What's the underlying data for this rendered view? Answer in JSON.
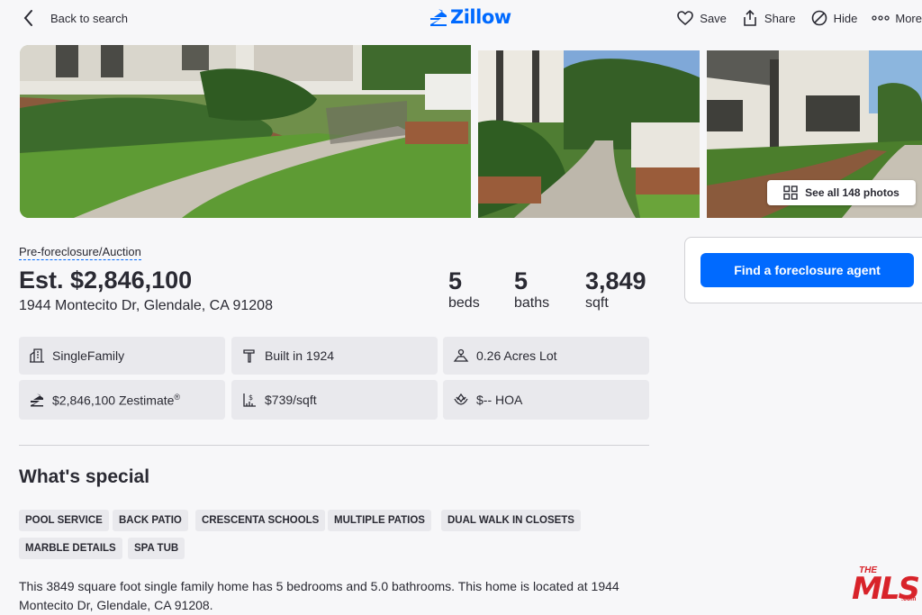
{
  "nav": {
    "back_label": "Back to search",
    "logo_text": "Zillow",
    "actions": {
      "save": "Save",
      "share": "Share",
      "hide": "Hide",
      "more": "More"
    }
  },
  "gallery": {
    "see_all_label": "See all 148 photos"
  },
  "listing": {
    "status": "Pre-foreclosure/Auction",
    "price": "Est. $2,846,100",
    "address": "1944 Montecito Dr, Glendale, CA 91208",
    "beds": {
      "value": "5",
      "label": "beds"
    },
    "baths": {
      "value": "5",
      "label": "baths"
    },
    "sqft": {
      "value": "3,849",
      "label": "sqft"
    }
  },
  "agent": {
    "button_label": "Find a foreclosure agent"
  },
  "facts": [
    {
      "icon": "building-icon",
      "text": "SingleFamily"
    },
    {
      "icon": "hammer-icon",
      "text": "Built in 1924"
    },
    {
      "icon": "lot-icon",
      "text": "0.26 Acres Lot"
    },
    {
      "icon": "zestimate-icon",
      "text": "$2,846,100 Zestimate",
      "sup": "®"
    },
    {
      "icon": "price-sqft-icon",
      "text": "$739/sqft"
    },
    {
      "icon": "hoa-icon",
      "text": "$-- HOA"
    }
  ],
  "special": {
    "title": "What's special",
    "tags": [
      "POOL SERVICE",
      "BACK PATIO",
      "CRESCENTA SCHOOLS",
      "MULTIPLE PATIOS",
      "DUAL WALK IN CLOSETS",
      "MARBLE DETAILS",
      "SPA TUB"
    ]
  },
  "description": "This 3849 square foot single family home has 5 bedrooms and 5.0 bathrooms. This home is located at 1944 Montecito Dr, Glendale, CA 91208.",
  "watermark": {
    "the": "THE",
    "mls": "MLS",
    "com": ".com"
  },
  "colors": {
    "accent": "#006aff",
    "tag_bg": "#e9e9ed",
    "mls_red": "#d8232a"
  }
}
